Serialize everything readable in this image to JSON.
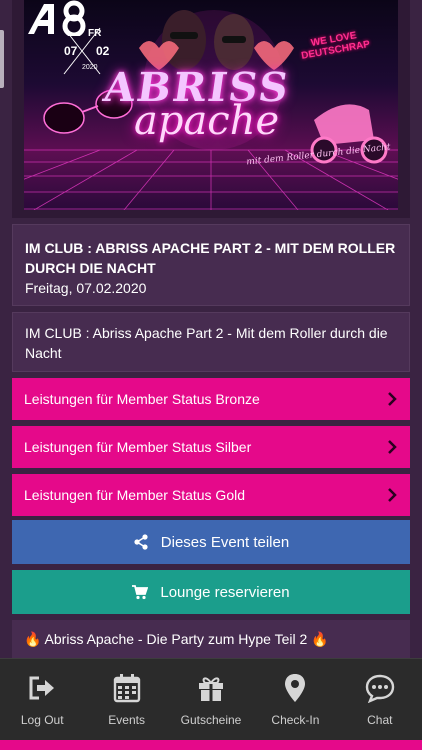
{
  "banner": {
    "day": "FR",
    "date_left": "07",
    "date_right": "02",
    "year": "2020",
    "headline_1": "ABRISS",
    "headline_2": "apache",
    "tagline_1": "WE LOVE",
    "tagline_2": "DEUTSCHRAP",
    "script": "mit dem Roller durch die Nacht"
  },
  "event": {
    "title": "IM CLUB : ABRISS APACHE PART 2 - MIT DEM ROLLER DURCH DIE NACHT",
    "date": "Freitag, 07.02.2020",
    "description": "IM CLUB : Abriss Apache Part 2 - Mit dem Roller durch die Nacht"
  },
  "member_buttons": [
    {
      "label": "Leistungen für Member Status Bronze"
    },
    {
      "label": "Leistungen für Member Status Silber"
    },
    {
      "label": "Leistungen für Member Status Gold"
    }
  ],
  "actions": {
    "share_label": "Dieses Event teilen",
    "lounge_label": "Lounge reservieren"
  },
  "promo": {
    "text": "🔥 Abriss Apache - Die Party zum Hype Teil 2 🔥"
  },
  "nav": [
    {
      "label": "Log Out",
      "icon": "logout-icon"
    },
    {
      "label": "Events",
      "icon": "calendar-icon"
    },
    {
      "label": "Gutscheine",
      "icon": "gift-icon"
    },
    {
      "label": "Check-In",
      "icon": "map-marker-icon"
    },
    {
      "label": "Chat",
      "icon": "chat-icon"
    }
  ],
  "colors": {
    "background": "#3a2342",
    "card": "#472c50",
    "member_button": "#e5098a",
    "share_button": "#3e67b1",
    "lounge_button": "#1b9e8c",
    "nav_background": "#2b2b2b"
  }
}
